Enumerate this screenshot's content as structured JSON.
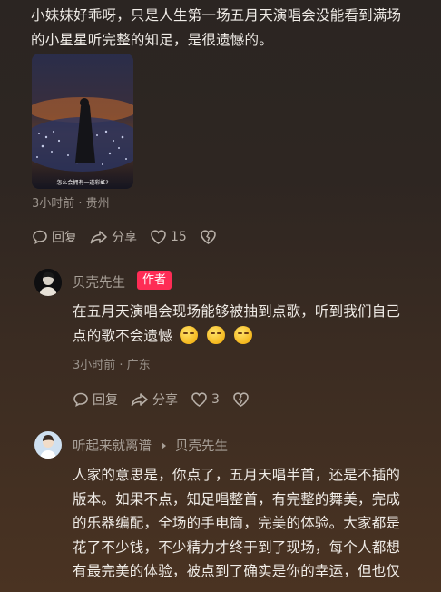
{
  "comment1": {
    "text_line1": "小妹妹好乖呀，只是人生第一场五月天演唱会没能看到满场",
    "text_line2": "的小星星听完整的知足，是很遗憾的。",
    "image_caption": "怎么会拥有一道彩虹?",
    "meta": "3小时前 · 贵州",
    "reply_label": "回复",
    "share_label": "分享",
    "like_count": "15"
  },
  "reply1": {
    "username": "贝壳先生",
    "author_badge": "作者",
    "text_line1": "在五月天演唱会现场能够被抽到点歌，听到我们自己",
    "text_line2": "点的歌不会遗憾",
    "meta": "3小时前 · 广东",
    "reply_label": "回复",
    "share_label": "分享",
    "like_count": "3",
    "colors": {
      "badge_bg": "#fe2c55"
    }
  },
  "reply2": {
    "username": "听起来就离谱",
    "reply_to": "贝壳先生",
    "lines": [
      "人家的意思是，你点了，五月天唱半首，还是不插的",
      "版本。如果不点，知足唱整首，有完整的舞美，完成",
      "的乐器编配，全场的手电筒，完美的体验。大家都是",
      "花了不少钱，不少精力才终于到了现场，每个人都想",
      "有最完美的体验，被点到了确实是你的幸运，但也仅"
    ]
  },
  "icons": [
    "comment-icon",
    "share-icon",
    "heart-icon",
    "broken-heart-icon",
    "caret-right-icon",
    "grin-emoji"
  ]
}
